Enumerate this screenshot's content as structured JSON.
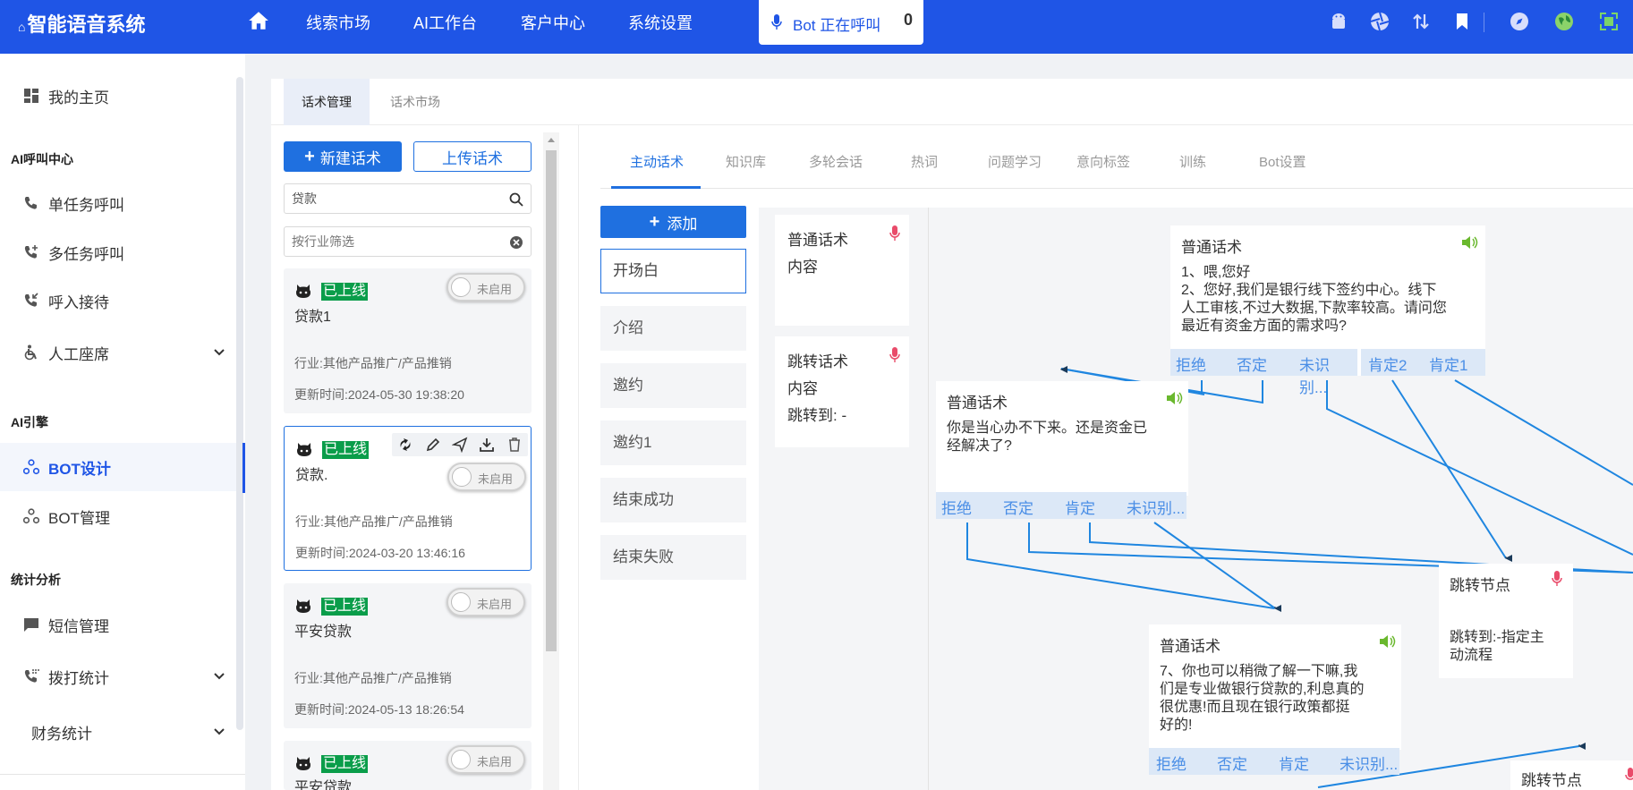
{
  "app": {
    "title": "智能语音系统",
    "nav": [
      "线索市场",
      "AI工作台",
      "客户中心",
      "系统设置"
    ],
    "call_status": {
      "label": "Bot 正在呼叫",
      "count": "0"
    },
    "top_icons": [
      "android-icon",
      "aperture-icon",
      "transfer-icon",
      "bookmark-icon",
      "compass-icon",
      "globe-icon",
      "fullscreen-icon"
    ]
  },
  "sidebar": {
    "home": "我的主页",
    "groups": {
      "call_center": "AI呼叫中心",
      "engine": "AI引擎",
      "stats": "统计分析"
    },
    "items": {
      "single_call": "单任务呼叫",
      "multi_call": "多任务呼叫",
      "inbound": "呼入接待",
      "agent_seat": "人工座席",
      "bot_design": "BOT设计",
      "bot_manage": "BOT管理",
      "sms": "短信管理",
      "dial_stats": "拨打统计",
      "finance": "财务统计"
    }
  },
  "page_tabs": [
    "话术管理",
    "话术市场"
  ],
  "script_list": {
    "new_button": "新建话术",
    "upload_button": "上传话术",
    "search_value": "贷款",
    "filter_placeholder": "按行业筛选",
    "cards": [
      {
        "status": "已上线",
        "name": "贷款1",
        "industry": "行业:其他产品推广/产品推销",
        "updated": "更新时间:2024-05-30 19:38:20",
        "toggle": "未启用"
      },
      {
        "status": "已上线",
        "name": "贷款.",
        "industry": "行业:其他产品推广/产品推销",
        "updated": "更新时间:2024-03-20 13:46:16",
        "toggle": "未启用"
      },
      {
        "status": "已上线",
        "name": "平安贷款",
        "industry": "行业:其他产品推广/产品推销",
        "updated": "更新时间:2024-05-13 18:26:54",
        "toggle": "未启用"
      },
      {
        "status": "已上线",
        "name": "平安贷款.",
        "toggle": "未启用"
      }
    ]
  },
  "script_tabs": [
    "主动话术",
    "知识库",
    "多轮会话",
    "热词",
    "问题学习",
    "意向标签",
    "训练",
    "Bot设置"
  ],
  "nodes_panel": {
    "add_button": "添加",
    "items": [
      "开场白",
      "介绍",
      "邀约",
      "邀约1",
      "结束成功",
      "结束失败"
    ]
  },
  "palette": [
    {
      "title": "普通话术",
      "line2": "内容",
      "line3": ""
    },
    {
      "title": "跳转话术",
      "line2": "内容",
      "line3": "跳转到: -"
    }
  ],
  "graph_nodes": {
    "n1": {
      "title": "普通话术",
      "lines": [
        "1、喂,您好",
        "2、您好,我们是银行线下签约中心。线下",
        "人工审核,不过大数据,下款率较高。请问您",
        "最近有资金方面的需求吗?"
      ],
      "branches_a": [
        "拒绝",
        "否定",
        "未识别..."
      ],
      "branches_b": [
        "肯定2",
        "肯定1"
      ]
    },
    "n2": {
      "title": "普通话术",
      "lines": [
        "你是当心办不下来。还是资金已",
        "经解决了?"
      ],
      "branches": [
        "拒绝",
        "否定",
        "肯定",
        "未识别..."
      ]
    },
    "n3": {
      "title": "普通话术",
      "lines": [
        "7、你也可以稍微了解一下嘛,我",
        "们是专业做银行贷款的,利息真的",
        "很优惠!而且现在银行政策都挺",
        "好的!"
      ],
      "branches": [
        "拒绝",
        "否定",
        "肯定",
        "未识别..."
      ]
    },
    "jump1": {
      "title": "跳转节点",
      "lines": [
        "跳转到:-指定主",
        "动流程"
      ]
    },
    "jump2": {
      "title": "跳转节点"
    }
  },
  "colors": {
    "brand": "#1f55e6",
    "primary": "#1f70e0",
    "online": "#0a9d4a",
    "edge": "#1f86e0"
  }
}
